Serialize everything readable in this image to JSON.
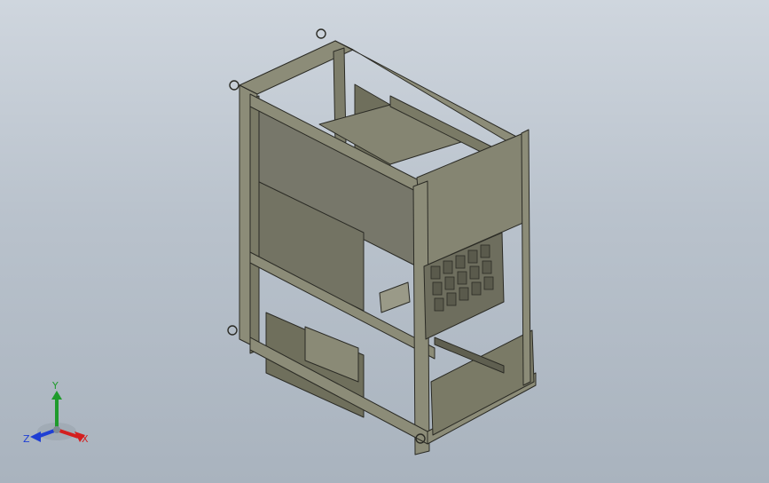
{
  "viewport": {
    "background_top": "#cfd6de",
    "background_bottom": "#a9b3be"
  },
  "model": {
    "type": "3D CAD assembly - isometric view",
    "body_color": "#7a7a66",
    "frame_color": "#8c8c78",
    "edge_color": "#2b2b25"
  },
  "triad": {
    "x_label": "X",
    "y_label": "Y",
    "z_label": "Z",
    "x_color": "#d41f1f",
    "y_color": "#1f9b2c",
    "z_color": "#1f3fd4"
  }
}
